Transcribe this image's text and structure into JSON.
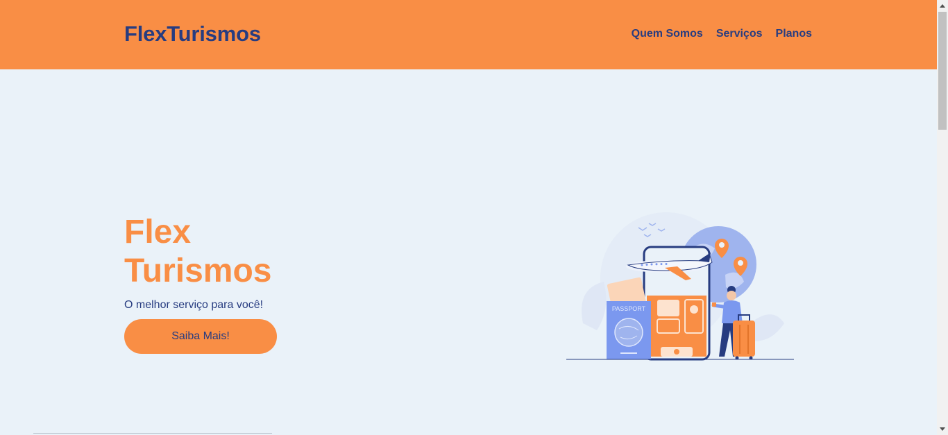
{
  "header": {
    "logo": "FlexTurismos",
    "nav": [
      "Quem Somos",
      "Serviços",
      "Planos"
    ]
  },
  "hero": {
    "title_line1": "Flex",
    "title_line2": "Turismos",
    "subtitle": "O melhor serviço para você!",
    "button_label": "Saiba Mais!"
  },
  "illustration": {
    "passport_label": "PASSPORT",
    "icons": [
      "airplane-icon",
      "location-pin-icon",
      "passport-icon",
      "suitcase-icon",
      "phone-icon",
      "traveler-icon",
      "checkmark-icon"
    ]
  },
  "colors": {
    "primary": "#f98e45",
    "navy": "#273c80",
    "background": "#eaf2f9",
    "illustration_blue": "#7b98ef"
  }
}
